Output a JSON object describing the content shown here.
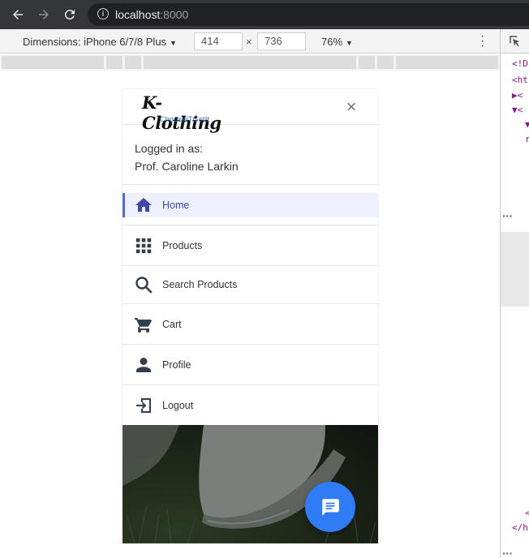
{
  "browser": {
    "url_host": "localhost",
    "url_port": ":8000"
  },
  "device_toolbar": {
    "device_label": "Dimensions: iPhone 6/7/8 Plus",
    "width": "414",
    "height": "736",
    "separator": "×",
    "zoom": "76%"
  },
  "devtools": {
    "code_lines": [
      "<!D",
      "<ht",
      "▶<",
      "▼<",
      "▼",
      "r",
      "<",
      "</h"
    ]
  },
  "app": {
    "logo_text": "K-Clothing",
    "logo_tagline": "ChooseITGetIt",
    "close_symbol": "×",
    "user": {
      "caption": "Logged in as:",
      "name": "Prof. Caroline Larkin"
    },
    "menu": [
      {
        "label": "Home",
        "icon": "home-icon",
        "active": true
      },
      {
        "label": "Products",
        "icon": "grid-icon",
        "active": false
      },
      {
        "label": "Search Products",
        "icon": "search-icon",
        "active": false
      },
      {
        "label": "Cart",
        "icon": "cart-icon",
        "active": false
      },
      {
        "label": "Profile",
        "icon": "person-icon",
        "active": false
      },
      {
        "label": "Logout",
        "icon": "logout-icon",
        "active": false
      }
    ],
    "colors": {
      "accent": "#5867dd",
      "active_bg": "#eef0fe",
      "fab": "#2f7cf6"
    }
  }
}
